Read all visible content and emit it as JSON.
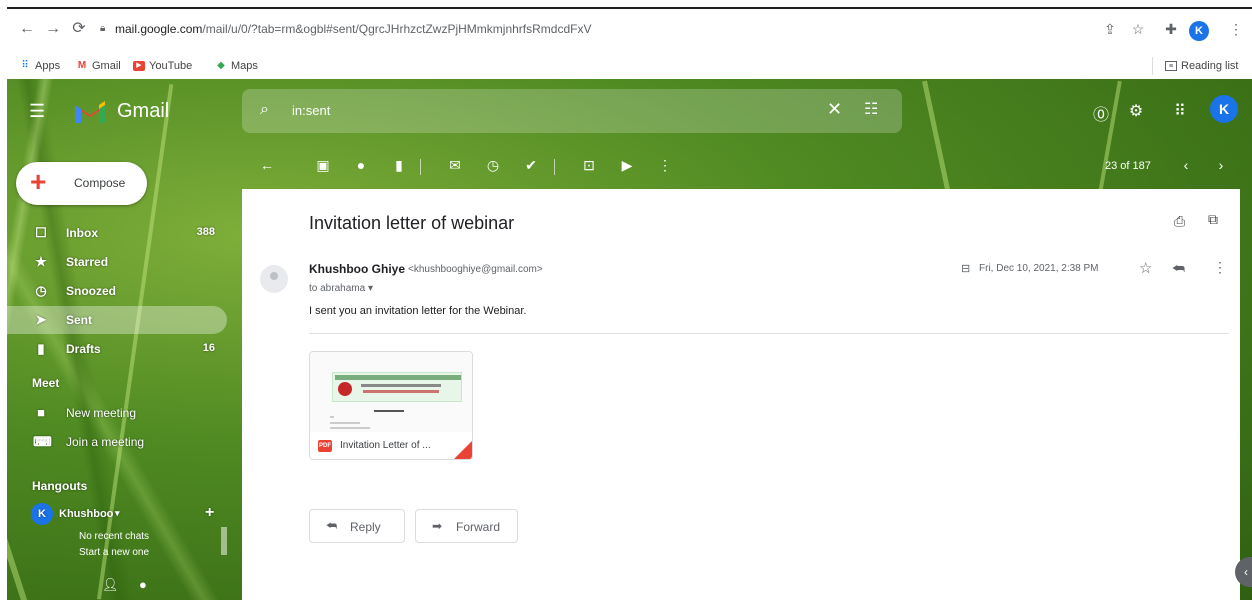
{
  "browser": {
    "url_host": "mail.google.com",
    "url_path": "/mail/u/0/?tab=rm&ogbl#sent/QgrcJHrhzctZwzPjHMmkmjnhrfsRmdcdFxV",
    "profile_initial": "K",
    "reading_list_label": "Reading list",
    "bookmarks": [
      {
        "label": "Apps",
        "icon": "apps-grid-icon"
      },
      {
        "label": "Gmail",
        "icon": "gmail-icon"
      },
      {
        "label": "YouTube",
        "icon": "youtube-icon"
      },
      {
        "label": "Maps",
        "icon": "maps-icon"
      }
    ]
  },
  "gmail": {
    "app_name": "Gmail",
    "search_query": "in:sent",
    "account_initial": "K",
    "compose_label": "Compose",
    "nav": [
      {
        "label": "Inbox",
        "count": "388",
        "icon": "inbox-icon"
      },
      {
        "label": "Starred",
        "count": "",
        "icon": "star-icon"
      },
      {
        "label": "Snoozed",
        "count": "",
        "icon": "clock-icon"
      },
      {
        "label": "Sent",
        "count": "",
        "icon": "send-icon",
        "active": true
      },
      {
        "label": "Drafts",
        "count": "16",
        "icon": "draft-icon"
      }
    ],
    "meet": {
      "heading": "Meet",
      "items": [
        {
          "label": "New meeting",
          "icon": "video-icon"
        },
        {
          "label": "Join a meeting",
          "icon": "keyboard-icon"
        }
      ]
    },
    "hangouts": {
      "heading": "Hangouts",
      "user": "Khushboo",
      "empty_line1": "No recent chats",
      "empty_line2": "Start a new one"
    },
    "pagination": "23 of 187"
  },
  "message": {
    "subject": "Invitation letter of webinar",
    "sender_name": "Khushboo Ghiye",
    "sender_email": "<khushbooghiye@gmail.com>",
    "to": "to abrahama",
    "date": "Fri, Dec 10, 2021, 2:38 PM",
    "body": "I sent you an invitation letter for the Webinar.",
    "attachment": {
      "name": "Invitation Letter of ...",
      "type_label": "PDF"
    },
    "reply_label": "Reply",
    "forward_label": "Forward"
  },
  "colors": {
    "accent_blue": "#1a73e8",
    "gmail_red": "#ea4335"
  }
}
